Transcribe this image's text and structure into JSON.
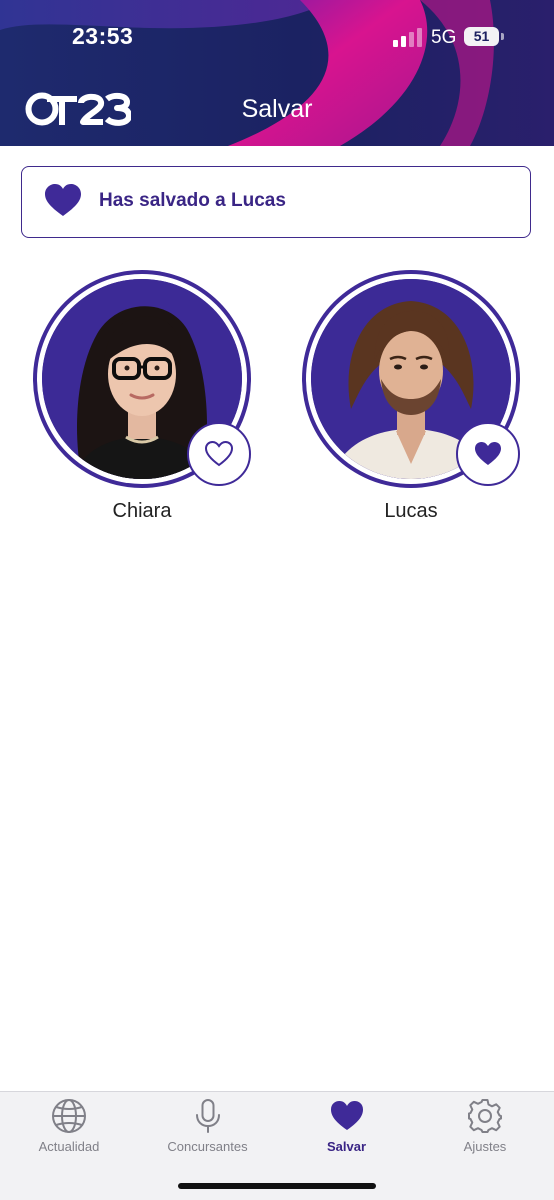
{
  "status_bar": {
    "time": "23:53",
    "network": "5G",
    "battery": "51"
  },
  "header": {
    "logo_text": "OT23",
    "title": "Salvar"
  },
  "banner": {
    "icon": "heart-filled-icon",
    "message": "Has salvado a Lucas"
  },
  "contestants": [
    {
      "name": "Chiara",
      "saved": false,
      "button_icon": "heart-outline-icon"
    },
    {
      "name": "Lucas",
      "saved": true,
      "button_icon": "heart-filled-icon"
    }
  ],
  "tab_bar": {
    "active": "Salvar",
    "tabs": [
      {
        "label": "Actualidad",
        "icon": "globe-icon"
      },
      {
        "label": "Concursantes",
        "icon": "microphone-icon"
      },
      {
        "label": "Salvar",
        "icon": "heart-filled-icon"
      },
      {
        "label": "Ajustes",
        "icon": "gear-icon"
      }
    ]
  },
  "colors": {
    "primary": "#3F2A98",
    "header_blue": "#1D2466",
    "header_magenta": "#E0148C",
    "inactive": "#808088"
  }
}
